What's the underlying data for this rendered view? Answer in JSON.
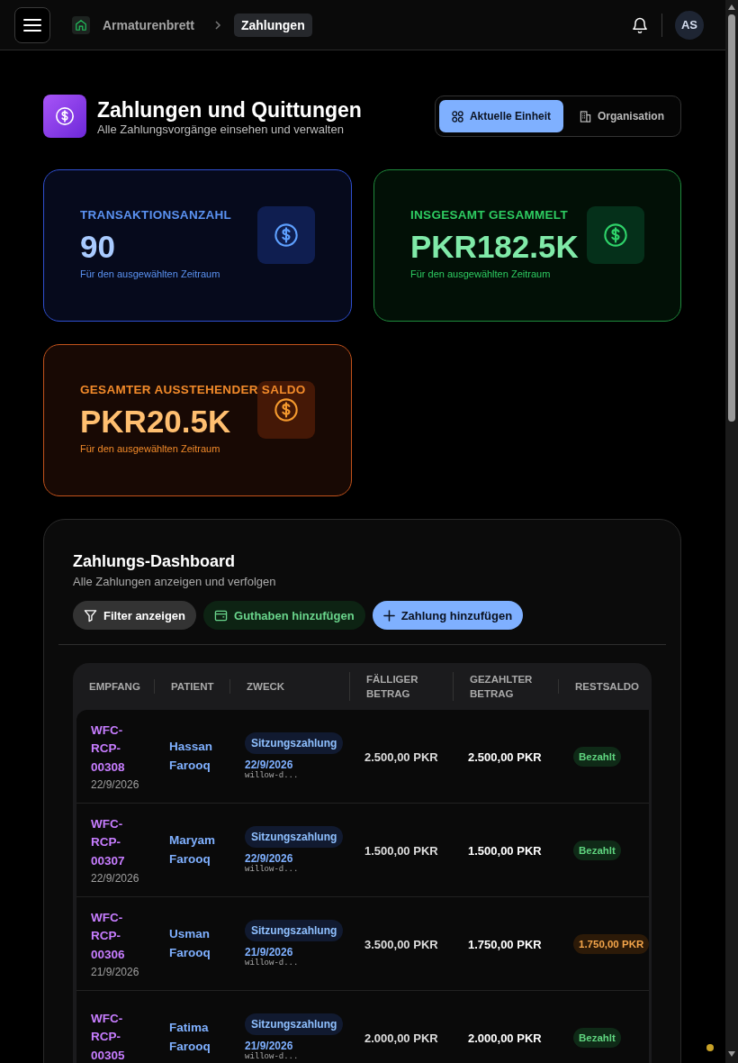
{
  "topbar": {
    "breadcrumbs": [
      {
        "label": "Armaturenbrett",
        "selected": false
      },
      {
        "label": "Zahlungen",
        "selected": true
      }
    ],
    "avatar": "AS"
  },
  "header": {
    "title": "Zahlungen und Quittungen",
    "subtitle": "Alle Zahlungsvorgänge einsehen und verwalten",
    "scope_tabs": [
      {
        "label": "Aktuelle Einheit",
        "kind": "unit",
        "selected": true
      },
      {
        "label": "Organisation",
        "kind": "org",
        "selected": false
      }
    ]
  },
  "stats": [
    {
      "kind": "blue",
      "label": "TRANSAKTIONSANZAHL",
      "value": "90",
      "note": "Für den ausgewählten Zeitraum"
    },
    {
      "kind": "green",
      "label": "INSGESAMT GESAMMELT",
      "value": "PKR182.5K",
      "note": "Für den ausgewählten Zeitraum"
    },
    {
      "kind": "orange",
      "label": "GESAMTER AUSSTEHENDER SALDO",
      "value": "PKR20.5K",
      "note": "Für den ausgewählten Zeitraum"
    }
  ],
  "dashboard": {
    "title": "Zahlungs-Dashboard",
    "subtitle": "Alle Zahlungen anzeigen und verfolgen",
    "actions": [
      {
        "kind": "filter",
        "label": "Filter anzeigen"
      },
      {
        "kind": "credit",
        "label": "Guthaben hinzufügen"
      },
      {
        "kind": "add",
        "label": "Zahlung hinzufügen"
      }
    ],
    "table": {
      "columns": [
        "EMPFANG",
        "PATIENT",
        "ZWECK",
        "FÄLLIGER BETRAG",
        "GEZAHLTER BETRAG",
        "RESTSALDO"
      ],
      "rows": [
        {
          "receipt": "WFC-RCP-00308",
          "receipt_date": "22/9/2026",
          "patient": "Hassan Farooq",
          "purpose": "Sitzungszahlung",
          "purpose_date": "22/9/2026",
          "purpose_ref": "willow-d...",
          "due": "2.500,00 PKR",
          "paid": "2.500,00 PKR",
          "balance": {
            "kind": "paid",
            "text": "Bezahlt"
          }
        },
        {
          "receipt": "WFC-RCP-00307",
          "receipt_date": "22/9/2026",
          "patient": "Maryam Farooq",
          "purpose": "Sitzungszahlung",
          "purpose_date": "22/9/2026",
          "purpose_ref": "willow-d...",
          "due": "1.500,00 PKR",
          "paid": "1.500,00 PKR",
          "balance": {
            "kind": "paid",
            "text": "Bezahlt"
          }
        },
        {
          "receipt": "WFC-RCP-00306",
          "receipt_date": "21/9/2026",
          "patient": "Usman Farooq",
          "purpose": "Sitzungszahlung",
          "purpose_date": "21/9/2026",
          "purpose_ref": "willow-d...",
          "due": "3.500,00 PKR",
          "paid": "1.750,00 PKR",
          "balance": {
            "kind": "due",
            "text": "1.750,00 PKR"
          }
        },
        {
          "receipt": "WFC-RCP-00305",
          "patient": "Fatima Farooq",
          "purpose": "Sitzungszahlung",
          "purpose_date": "21/9/2026",
          "purpose_ref": "willow-d...",
          "due": "2.000,00 PKR",
          "paid": "2.000,00 PKR",
          "balance": {
            "kind": "paid",
            "text": "Bezahlt"
          }
        }
      ]
    }
  }
}
